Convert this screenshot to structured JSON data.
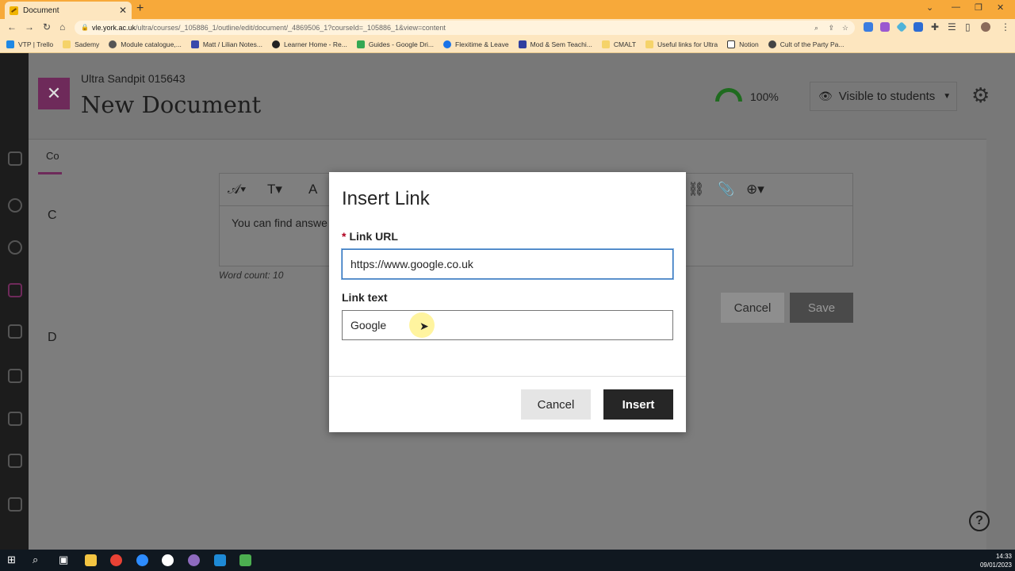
{
  "browser": {
    "tab_title": "Document",
    "new_tab": "+",
    "url_host": "vle.york.ac.uk",
    "url_path": "/ultra/courses/_105886_1/outline/edit/document/_4869506_1?courseId=_105886_1&view=content",
    "bookmarks": [
      "VTP | Trello",
      "Sademy",
      "Module catalogue,...",
      "Matt / Lilian Notes...",
      "Learner Home - Re...",
      "Guides - Google Dri...",
      "Flexitime & Leave",
      "Mod & Sem Teachi...",
      "CMALT",
      "Useful links for Ultra",
      "Notion",
      "Cult of the Party Pa..."
    ]
  },
  "header": {
    "course_name": "Ultra Sandpit 015643",
    "doc_title": "New Document",
    "progress": "100%",
    "visibility": "Visible to students"
  },
  "editor": {
    "text": "You can find answe",
    "word_count": "Word count: 10",
    "cancel_label": "Cancel",
    "save_label": "Save"
  },
  "side_letters": {
    "tab": "Co",
    "c": "C",
    "d": "D"
  },
  "dialog": {
    "title": "Insert Link",
    "required_mark": "*",
    "url_label": "Link URL",
    "url_value": "https://www.google.co.uk",
    "text_label": "Link text",
    "text_value": "Google",
    "cancel_label": "Cancel",
    "insert_label": "Insert"
  },
  "taskbar": {
    "time": "14:33",
    "date": "09/01/2023"
  },
  "colors": {
    "tabbar": "#f7a93a",
    "accent_purple": "#6e2a5a",
    "progress_green": "#1f6b1f",
    "insert_button": "#262626",
    "focus_blue": "#2a6ebb"
  }
}
